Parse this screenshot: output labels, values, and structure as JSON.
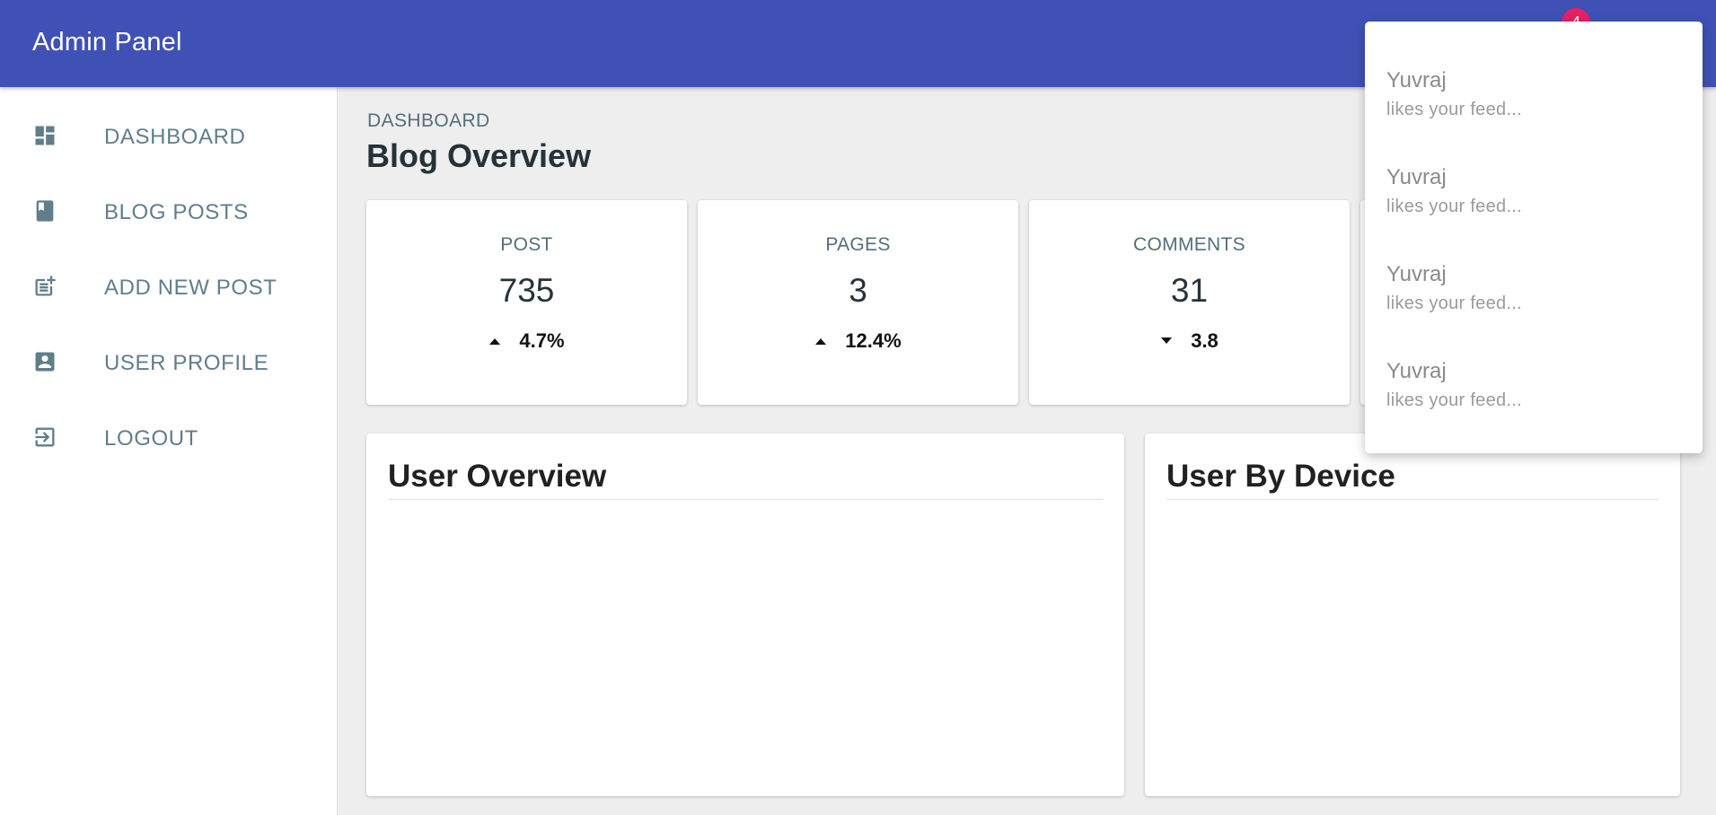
{
  "app": {
    "title": "Admin Panel",
    "notification_count": "4"
  },
  "colors": {
    "appbar": "#3f51b5",
    "badge": "#e91e63",
    "nav_text": "#607d8b"
  },
  "sidebar": {
    "items": [
      {
        "label": "DASHBOARD",
        "icon": "dashboard-icon"
      },
      {
        "label": "BLOG POSTS",
        "icon": "book-icon"
      },
      {
        "label": "ADD NEW POST",
        "icon": "post-add-icon"
      },
      {
        "label": "USER PROFILE",
        "icon": "account-box-icon"
      },
      {
        "label": "LOGOUT",
        "icon": "exit-icon"
      }
    ]
  },
  "main": {
    "breadcrumb": "DASHBOARD",
    "title": "Blog Overview",
    "stats": [
      {
        "label": "POST",
        "value": "735",
        "change": "4.7%",
        "direction": "up"
      },
      {
        "label": "PAGES",
        "value": "3",
        "change": "12.4%",
        "direction": "up"
      },
      {
        "label": "COMMENTS",
        "value": "31",
        "change": "3.8",
        "direction": "down"
      }
    ],
    "panels": [
      {
        "title": "User Overview"
      },
      {
        "title": "User By Device"
      }
    ]
  },
  "notifications": [
    {
      "name": "Yuvraj",
      "message": "likes your feed..."
    },
    {
      "name": "Yuvraj",
      "message": "likes your feed..."
    },
    {
      "name": "Yuvraj",
      "message": "likes your feed..."
    },
    {
      "name": "Yuvraj",
      "message": "likes your feed..."
    }
  ]
}
